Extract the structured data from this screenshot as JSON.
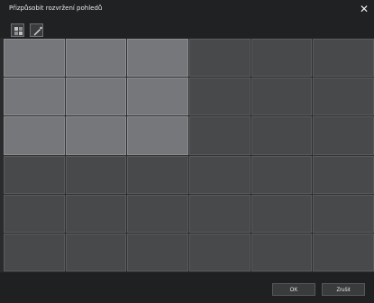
{
  "window": {
    "title": "Přizpůsobit rozvržení pohledů",
    "close_glyph": "✕"
  },
  "toolbar": {
    "items": [
      {
        "icon": "layout-icon"
      },
      {
        "icon": "pencil-icon"
      }
    ]
  },
  "grid": {
    "rows": 6,
    "cols": 6,
    "selected": {
      "row_start": 0,
      "row_end": 2,
      "col_start": 0,
      "col_end": 2
    }
  },
  "buttons": {
    "ok_label": "OK",
    "cancel_label": "Zrušit"
  },
  "colors": {
    "selected_cell": "#75777b",
    "cell": "#48494b",
    "background": "#202122"
  }
}
